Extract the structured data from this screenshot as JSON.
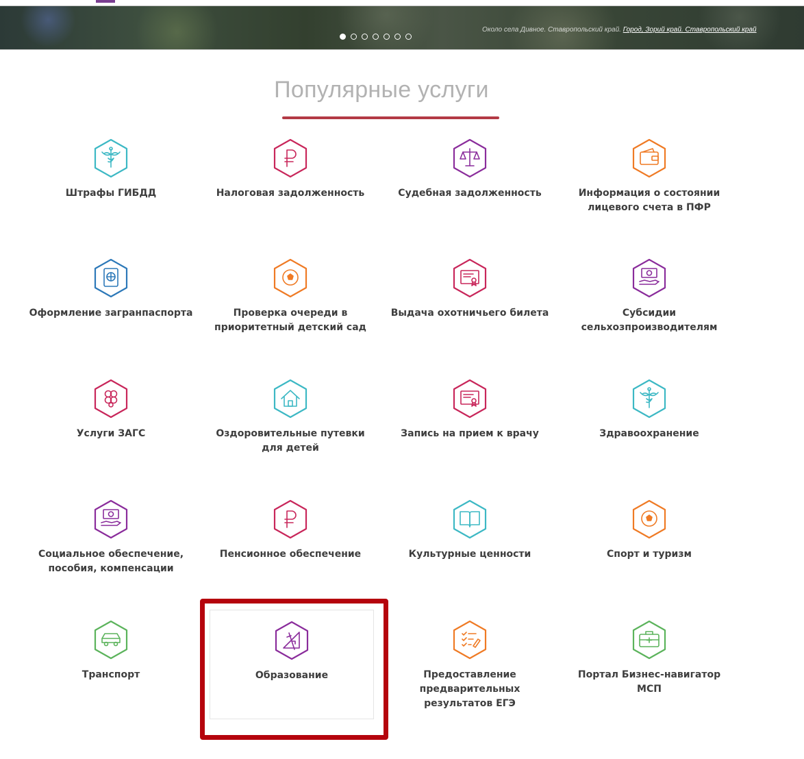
{
  "banner": {
    "caption_text": "Около села Дивное. Ставропольский край. ",
    "caption_link": "Город, Зорий край. Ставропольский край",
    "slide_count": 7,
    "active_slide": 1
  },
  "section": {
    "title": "Популярные услуги",
    "accent_color": "#b33a45"
  },
  "highlight": {
    "color": "#b5040d",
    "target": "Образование"
  },
  "services": [
    {
      "label": "Штрафы ГИБДД",
      "icon": "medical-caduceus-icon",
      "color": "#3cb8c4"
    },
    {
      "label": "Налоговая задолженность",
      "icon": "ruble-icon",
      "color": "#c8265a"
    },
    {
      "label": "Судебная задолженность",
      "icon": "scales-icon",
      "color": "#8a2c9b"
    },
    {
      "label": "Информация о состоянии лицевого счета в ПФР",
      "icon": "wallet-icon",
      "color": "#ef7a24"
    },
    {
      "label": "Оформление загранпаспорта",
      "icon": "passport-icon",
      "color": "#2c78b8"
    },
    {
      "label": "Проверка очереди в приоритетный детский сад",
      "icon": "ball-icon",
      "color": "#ef7a24"
    },
    {
      "label": "Выдача охотничьего билета",
      "icon": "certificate-icon",
      "color": "#c8265a"
    },
    {
      "label": "Субсидии сельхозпроизводителям",
      "icon": "money-hand-icon",
      "color": "#8a2c9b"
    },
    {
      "label": "Услуги ЗАГС",
      "icon": "rings-icon",
      "color": "#c8265a"
    },
    {
      "label": "Оздоровительные путевки для детей",
      "icon": "house-icon",
      "color": "#3cb8c4"
    },
    {
      "label": "Запись на прием к врачу",
      "icon": "certificate-icon",
      "color": "#c8265a"
    },
    {
      "label": "Здравоохранение",
      "icon": "medical-caduceus-icon",
      "color": "#3cb8c4"
    },
    {
      "label": "Социальное обеспечение, пособия, компенсации",
      "icon": "money-hand-icon",
      "color": "#8a2c9b"
    },
    {
      "label": "Пенсионное обеспечение",
      "icon": "ruble-icon",
      "color": "#c8265a"
    },
    {
      "label": "Культурные ценности",
      "icon": "book-icon",
      "color": "#3cb8c4"
    },
    {
      "label": "Спорт и туризм",
      "icon": "ball-icon",
      "color": "#ef7a24"
    },
    {
      "label": "Транспорт",
      "icon": "car-icon",
      "color": "#5bb35b"
    },
    {
      "label": "Образование",
      "icon": "drafting-icon",
      "color": "#8a2c9b"
    },
    {
      "label": "Предоставление предварительных результатов ЕГЭ",
      "icon": "checklist-icon",
      "color": "#ef7a24"
    },
    {
      "label": "Портал Бизнес-навигатор МСП",
      "icon": "briefcase-icon",
      "color": "#5bb35b"
    }
  ]
}
